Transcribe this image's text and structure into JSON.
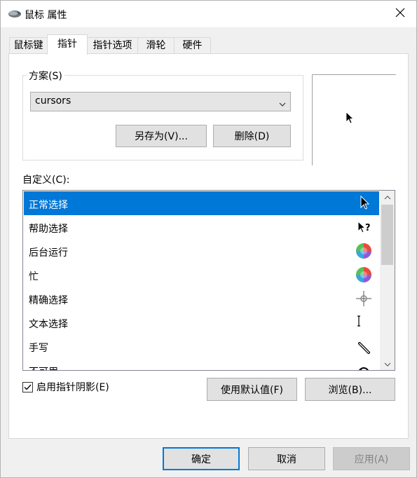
{
  "window": {
    "title": "鼠标 属性"
  },
  "tabs": [
    {
      "label": "鼠标键",
      "active": false
    },
    {
      "label": "指针",
      "active": true
    },
    {
      "label": "指针选项",
      "active": false
    },
    {
      "label": "滑轮",
      "active": false
    },
    {
      "label": "硬件",
      "active": false
    }
  ],
  "scheme": {
    "group_label": "方案(S)",
    "selected": "cursors",
    "save_as_label": "另存为(V)...",
    "delete_label": "删除(D)"
  },
  "customize": {
    "label": "自定义(C):",
    "items": [
      {
        "label": "正常选择",
        "icon": "arrow-cursor-icon",
        "selected": true
      },
      {
        "label": "帮助选择",
        "icon": "help-cursor-icon",
        "selected": false
      },
      {
        "label": "后台运行",
        "icon": "working-cursor-icon",
        "selected": false
      },
      {
        "label": "忙",
        "icon": "busy-cursor-icon",
        "selected": false
      },
      {
        "label": "精确选择",
        "icon": "crosshair-cursor-icon",
        "selected": false
      },
      {
        "label": "文本选择",
        "icon": "text-cursor-icon",
        "selected": false
      },
      {
        "label": "手写",
        "icon": "pen-cursor-icon",
        "selected": false
      },
      {
        "label": "不可用",
        "icon": "unavailable-cursor-icon",
        "selected": false
      }
    ]
  },
  "shadow": {
    "label": "启用指针阴影(E)",
    "checked": true
  },
  "actions": {
    "use_default_label": "使用默认值(F)",
    "browse_label": "浏览(B)..."
  },
  "footer": {
    "ok_label": "确定",
    "cancel_label": "取消",
    "apply_label": "应用(A)"
  },
  "colors": {
    "accent": "#0078d7",
    "panel": "#ffffff",
    "dialog_bg": "#f0f0f0"
  }
}
